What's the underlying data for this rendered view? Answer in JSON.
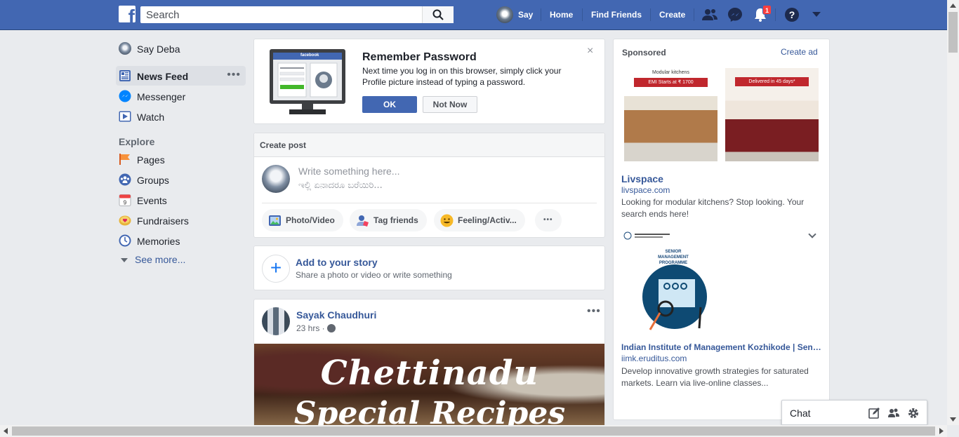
{
  "topbar": {
    "logo": "f",
    "search_placeholder": "Search",
    "user_short": "Say",
    "nav": [
      "Home",
      "Find Friends",
      "Create"
    ],
    "notification_count": "1"
  },
  "left_nav": {
    "user": "Say Deba",
    "items": [
      {
        "label": "News Feed",
        "icon": "news-feed-icon"
      },
      {
        "label": "Messenger",
        "icon": "messenger-icon"
      },
      {
        "label": "Watch",
        "icon": "watch-icon"
      }
    ],
    "explore_heading": "Explore",
    "explore_items": [
      {
        "label": "Pages",
        "icon": "flag-icon"
      },
      {
        "label": "Groups",
        "icon": "groups-icon"
      },
      {
        "label": "Events",
        "icon": "calendar-icon"
      },
      {
        "label": "Fundraisers",
        "icon": "fundraiser-icon"
      },
      {
        "label": "Memories",
        "icon": "clock-icon"
      }
    ],
    "see_more": "See more..."
  },
  "remember_password": {
    "title": "Remember Password",
    "text": "Next time you log in on this browser, simply click your Profile picture instead of typing a password.",
    "ok": "OK",
    "not_now": "Not Now",
    "close": "×",
    "illustration_brand": "facebook"
  },
  "create_post": {
    "header": "Create post",
    "placeholder_en": "Write something here...",
    "placeholder_kn": "ಇಲ್ಲಿ ಏನಾದರೂ ಬರೆಯಿರಿ...",
    "actions": [
      "Photo/Video",
      "Tag friends",
      "Feeling/Activ...",
      "•••"
    ]
  },
  "story": {
    "title": "Add to your story",
    "subtitle": "Share a photo or video or write something"
  },
  "post": {
    "author": "Sayak Chaudhuri",
    "time": "23 hrs ·",
    "image_line1": "Chettinadu",
    "image_line2": "Special Recipes"
  },
  "sponsored": {
    "title": "Sponsored",
    "create_ad": "Create ad",
    "ad1": {
      "img1_banner": "Modular kitchens",
      "img1_bar": "EMI Starts at ₹ 1700",
      "img2_bar": "Delivered in 45 days*",
      "name": "Livspace",
      "domain": "livspace.com",
      "desc": "Looking for modular kitchens? Stop looking. Your search ends here!"
    },
    "ad2": {
      "program": "SENIOR MANAGEMENT PROGRAMME",
      "name": "Indian Institute of Management Kozhikode | Senior Management Programme",
      "domain": "iimk.eruditus.com",
      "desc": "Develop innovative growth strategies for saturated markets. Learn via live-online classes..."
    }
  },
  "chat": {
    "label": "Chat"
  },
  "colors": {
    "brand": "#4267b2",
    "link": "#365899",
    "badge": "#fa3e3e"
  }
}
